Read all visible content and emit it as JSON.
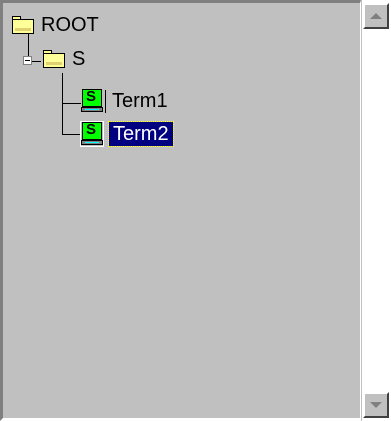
{
  "tree": {
    "root": {
      "label": "ROOT",
      "icon": "folder-icon"
    },
    "folder_s": {
      "label": "S",
      "icon": "folder-icon",
      "expanded": true
    },
    "items": [
      {
        "label": "Term1",
        "icon": "terminal-icon",
        "icon_text": "S",
        "selected": false
      },
      {
        "label": "Term2",
        "icon": "terminal-icon",
        "icon_text": "S",
        "selected": true
      }
    ]
  },
  "scrollbar": {
    "up_icon": "scroll-up-arrow-icon",
    "down_icon": "scroll-down-arrow-icon"
  },
  "colors": {
    "panel_bg": "#c0c0c0",
    "selection_bg": "#000080",
    "selection_text": "#ffffff",
    "terminal_screen": "#00ff00",
    "folder": "#ffff99"
  }
}
